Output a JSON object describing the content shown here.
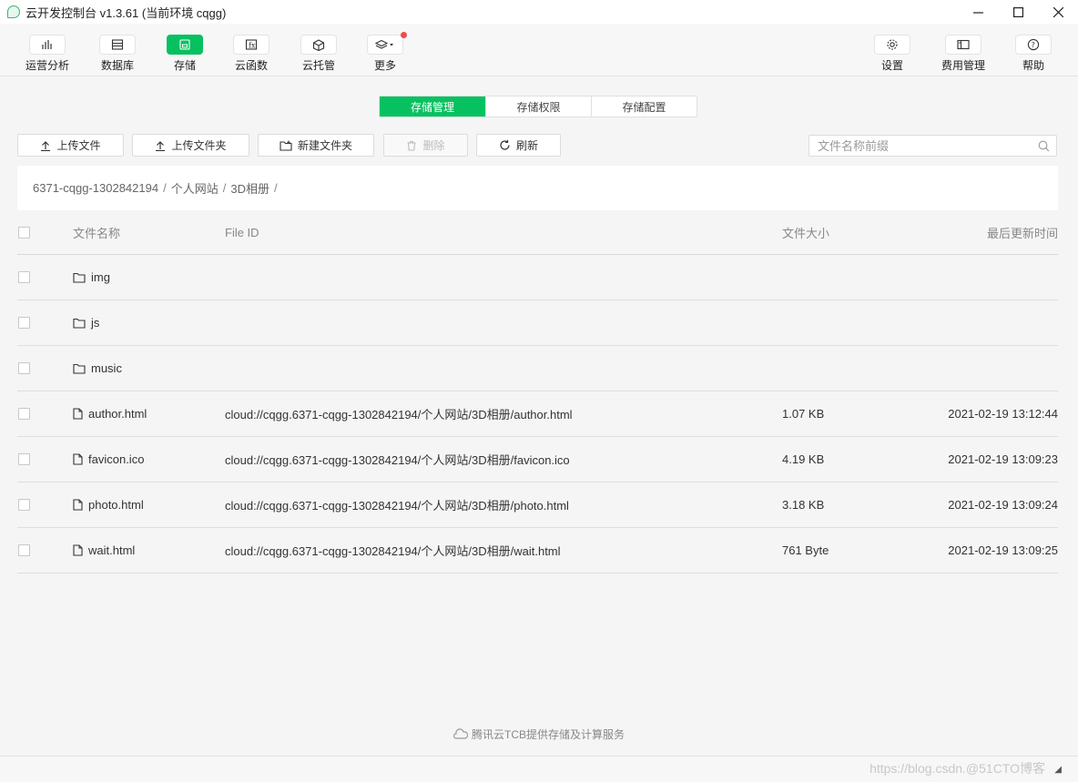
{
  "window": {
    "title": "云开发控制台 v1.3.61 (当前环境 cqgg)"
  },
  "toolbar": {
    "items": [
      {
        "label": "运营分析",
        "icon": "bar-chart-icon"
      },
      {
        "label": "数据库",
        "icon": "database-icon"
      },
      {
        "label": "存储",
        "icon": "storage-icon"
      },
      {
        "label": "云函数",
        "icon": "function-icon"
      },
      {
        "label": "云托管",
        "icon": "cube-icon"
      },
      {
        "label": "更多",
        "icon": "layers-icon"
      }
    ],
    "right_items": [
      {
        "label": "设置",
        "icon": "gear-icon"
      },
      {
        "label": "费用管理",
        "icon": "billing-icon"
      },
      {
        "label": "帮助",
        "icon": "help-icon"
      }
    ],
    "active": "存储"
  },
  "tabs": [
    "存储管理",
    "存储权限",
    "存储配置"
  ],
  "actions": {
    "upload_file": "上传文件",
    "upload_folder": "上传文件夹",
    "new_folder": "新建文件夹",
    "delete": "删除",
    "refresh": "刷新"
  },
  "search": {
    "placeholder": "文件名称前缀"
  },
  "breadcrumb": [
    "6371-cqgg-1302842194",
    "个人网站",
    "3D相册"
  ],
  "breadcrumb_sep": "/",
  "table": {
    "headers": {
      "name": "文件名称",
      "file_id": "File ID",
      "size": "文件大小",
      "time": "最后更新时间"
    },
    "rows": [
      {
        "type": "folder",
        "name": "img",
        "file_id": "",
        "size": "",
        "time": ""
      },
      {
        "type": "folder",
        "name": "js",
        "file_id": "",
        "size": "",
        "time": ""
      },
      {
        "type": "folder",
        "name": "music",
        "file_id": "",
        "size": "",
        "time": ""
      },
      {
        "type": "file",
        "name": "author.html",
        "file_id": "cloud://cqgg.6371-cqgg-1302842194/个人网站/3D相册/author.html",
        "size": "1.07 KB",
        "time": "2021-02-19 13:12:44"
      },
      {
        "type": "file",
        "name": "favicon.ico",
        "file_id": "cloud://cqgg.6371-cqgg-1302842194/个人网站/3D相册/favicon.ico",
        "size": "4.19 KB",
        "time": "2021-02-19 13:09:23"
      },
      {
        "type": "file",
        "name": "photo.html",
        "file_id": "cloud://cqgg.6371-cqgg-1302842194/个人网站/3D相册/photo.html",
        "size": "3.18 KB",
        "time": "2021-02-19 13:09:24"
      },
      {
        "type": "file",
        "name": "wait.html",
        "file_id": "cloud://cqgg.6371-cqgg-1302842194/个人网站/3D相册/wait.html",
        "size": "761 Byte",
        "time": "2021-02-19 13:09:25"
      }
    ]
  },
  "footer": {
    "text": "腾讯云TCB提供存储及计算服务"
  },
  "watermark": "https://blog.csdn.@51CTO博客",
  "colors": {
    "accent": "#07c160",
    "notification_dot": "#f04b4b"
  }
}
